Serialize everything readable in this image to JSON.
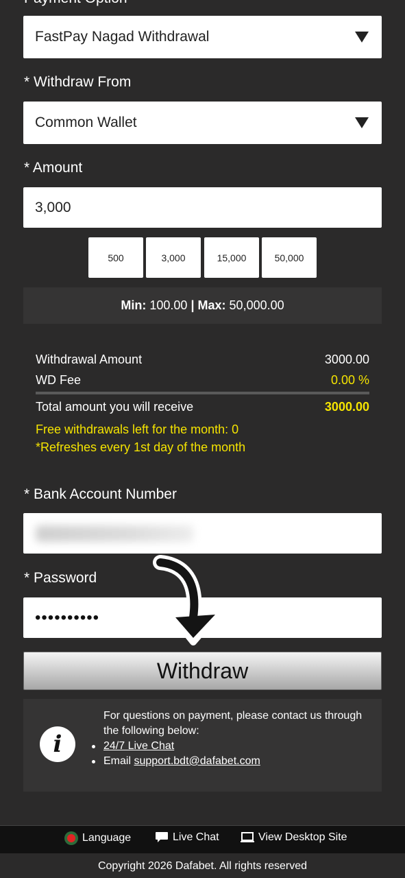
{
  "payment_option": {
    "label": "Payment Option",
    "value": "FastPay Nagad Withdrawal"
  },
  "withdraw_from": {
    "label": "* Withdraw From",
    "value": "Common Wallet"
  },
  "amount": {
    "label": "* Amount",
    "value": "3,000",
    "chips": [
      "500",
      "3,000",
      "15,000",
      "50,000"
    ]
  },
  "limits": {
    "min_label": "Min:",
    "min_value": "100.00",
    "separator": "|",
    "max_label": "Max:",
    "max_value": "50,000.00"
  },
  "summary": {
    "withdrawal_amount_label": "Withdrawal Amount",
    "withdrawal_amount_value": "3000.00",
    "wd_fee_label": "WD Fee",
    "wd_fee_value": "0.00 %",
    "total_label": "Total amount you will receive",
    "total_value": "3000.00",
    "free_withdrawals": "Free withdrawals left for the month: 0",
    "refresh_note": "*Refreshes every 1st day of the month"
  },
  "bank_account": {
    "label": "* Bank Account Number"
  },
  "password": {
    "label": "* Password",
    "value": "••••••••••"
  },
  "withdraw_button": "Withdraw",
  "info": {
    "text": "For questions on payment, please contact us through the following below:",
    "live_chat": "24/7 Live Chat",
    "email_prefix": "Email",
    "email": "support.bdt@dafabet.com"
  },
  "footer": {
    "language": "Language",
    "live_chat": "Live Chat",
    "desktop": "View Desktop Site",
    "copyright": "Copyright 2026 Dafabet. All rights reserved"
  },
  "colors": {
    "background": "#2b2a2a",
    "panel": "#353434",
    "highlight": "#f5e400",
    "footer": "#111111"
  },
  "icons": [
    "dropdown-caret-icon",
    "info-icon",
    "language-flag-icon",
    "chat-bubble-icon",
    "monitor-icon",
    "arrow-pointer-icon"
  ]
}
